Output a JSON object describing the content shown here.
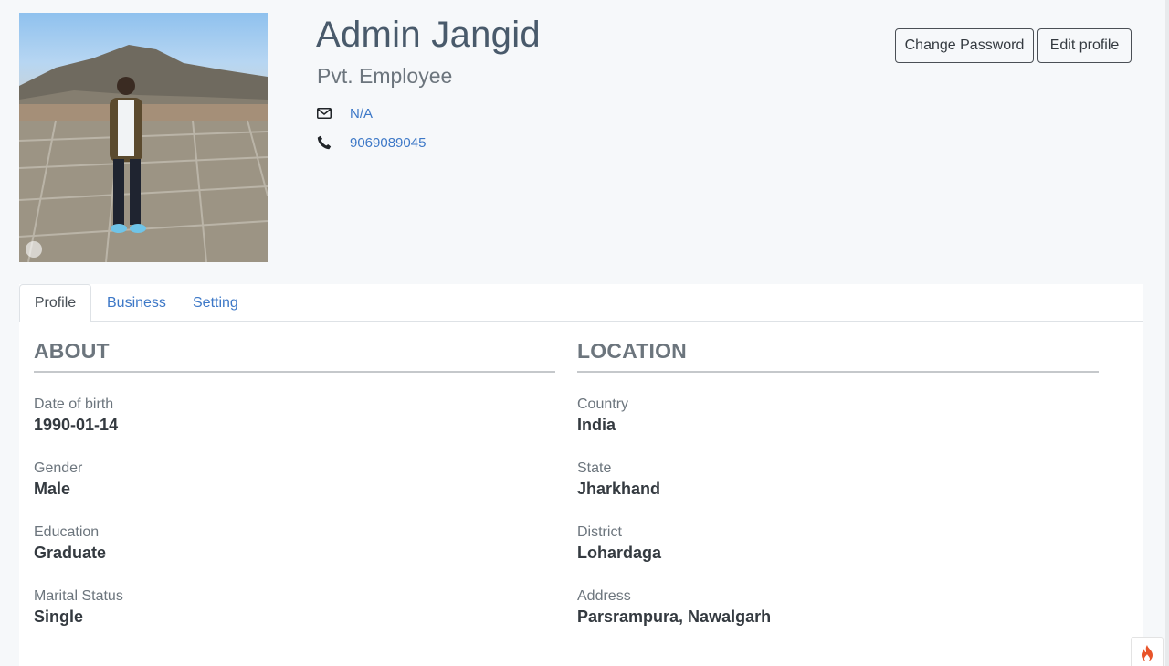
{
  "profile": {
    "name": "Admin Jangid",
    "role": "Pvt. Employee",
    "email": "N/A",
    "phone": "9069089045"
  },
  "actions": {
    "change_password": "Change Password",
    "edit_profile": "Edit profile"
  },
  "tabs": [
    {
      "label": "Profile",
      "active": true
    },
    {
      "label": "Business",
      "active": false
    },
    {
      "label": "Setting",
      "active": false
    }
  ],
  "about": {
    "title": "ABOUT",
    "fields": [
      {
        "label": "Date of birth",
        "value": "1990-01-14"
      },
      {
        "label": "Gender",
        "value": "Male"
      },
      {
        "label": "Education",
        "value": "Graduate"
      },
      {
        "label": "Marital Status",
        "value": "Single"
      }
    ]
  },
  "location": {
    "title": "LOCATION",
    "fields": [
      {
        "label": "Country",
        "value": "India"
      },
      {
        "label": "State",
        "value": "Jharkhand"
      },
      {
        "label": "District",
        "value": "Lohardaga"
      },
      {
        "label": "Address",
        "value": "Parsrampura, Nawalgarh"
      }
    ]
  },
  "colors": {
    "link": "#3d78c7",
    "heading": "#495a6b",
    "muted": "#6c757d",
    "background": "#f6f8fa"
  },
  "icons": [
    "envelope-icon",
    "phone-icon",
    "flame-icon"
  ]
}
